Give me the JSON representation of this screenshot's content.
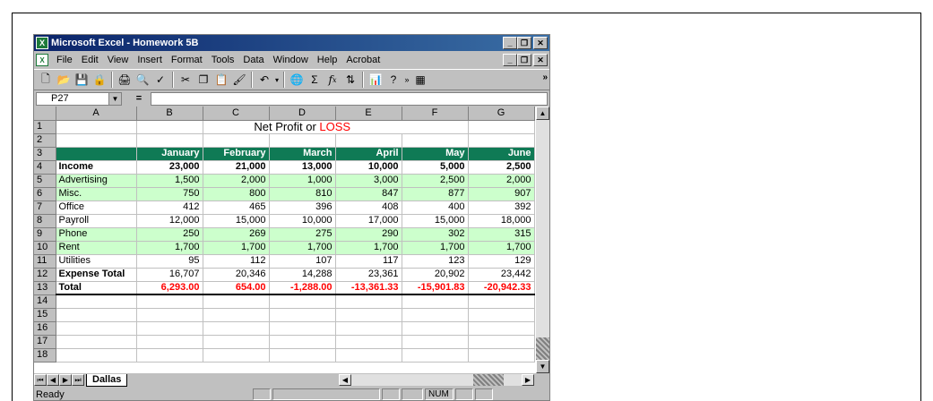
{
  "window": {
    "title": "Microsoft Excel - Homework 5B",
    "app_icon": "excel-icon",
    "controls": [
      "_",
      "И",
      "×"
    ]
  },
  "menu": {
    "items": [
      {
        "label": "File",
        "accel": "F"
      },
      {
        "label": "Edit",
        "accel": "E"
      },
      {
        "label": "View",
        "accel": "V"
      },
      {
        "label": "Insert",
        "accel": "I"
      },
      {
        "label": "Format",
        "accel": "o"
      },
      {
        "label": "Tools",
        "accel": "T"
      },
      {
        "label": "Data",
        "accel": "D"
      },
      {
        "label": "Window",
        "accel": "W"
      },
      {
        "label": "Help",
        "accel": "H"
      },
      {
        "label": "Acrobat",
        "accel": "b"
      }
    ]
  },
  "toolbar": {
    "buttons": [
      "new-icon",
      "open-icon",
      "save-icon",
      "permission-icon",
      "print-icon",
      "print-preview-icon",
      "spelling-icon",
      "cut-icon",
      "copy-icon",
      "paste-icon",
      "format-painter-icon",
      "undo-icon",
      "hyperlink-icon",
      "autosum-icon",
      "function-icon",
      "sort-ascending-icon",
      "chart-wizard-icon",
      "help-icon",
      "more-buttons-icon",
      "borders-icon"
    ]
  },
  "formula_bar": {
    "name_box": "P27",
    "equals": "=",
    "formula": ""
  },
  "columns": [
    "A",
    "B",
    "C",
    "D",
    "E",
    "F",
    "G"
  ],
  "rows": [
    {
      "n": "1",
      "type": "title",
      "cells": []
    },
    {
      "n": "2",
      "type": "empty",
      "cells": [
        "",
        "",
        "",
        "",
        "",
        "",
        ""
      ]
    },
    {
      "n": "3",
      "type": "hdr",
      "cells": [
        "",
        "January",
        "February",
        "March",
        "April",
        "May",
        "June"
      ]
    },
    {
      "n": "4",
      "type": "bold",
      "cells": [
        "Income",
        "23,000",
        "21,000",
        "13,000",
        "10,000",
        "5,000",
        "2,500"
      ]
    },
    {
      "n": "5",
      "type": "shade",
      "cells": [
        "Advertising",
        "1,500",
        "2,000",
        "1,000",
        "3,000",
        "2,500",
        "2,000"
      ]
    },
    {
      "n": "6",
      "type": "shade",
      "cells": [
        "Misc.",
        "750",
        "800",
        "810",
        "847",
        "877",
        "907"
      ]
    },
    {
      "n": "7",
      "type": "plain",
      "cells": [
        "Office",
        "412",
        "465",
        "396",
        "408",
        "400",
        "392"
      ]
    },
    {
      "n": "8",
      "type": "plain",
      "cells": [
        "Payroll",
        "12,000",
        "15,000",
        "10,000",
        "17,000",
        "15,000",
        "18,000"
      ]
    },
    {
      "n": "9",
      "type": "shade",
      "cells": [
        "Phone",
        "250",
        "269",
        "275",
        "290",
        "302",
        "315"
      ]
    },
    {
      "n": "10",
      "type": "shade",
      "cells": [
        "Rent",
        "1,700",
        "1,700",
        "1,700",
        "1,700",
        "1,700",
        "1,700"
      ]
    },
    {
      "n": "11",
      "type": "plain",
      "cells": [
        "Utilities",
        "95",
        "112",
        "107",
        "117",
        "123",
        "129"
      ]
    },
    {
      "n": "12",
      "type": "plainbold",
      "cells": [
        "Expense Total",
        "16,707",
        "20,346",
        "14,288",
        "23,361",
        "20,902",
        "23,442"
      ]
    },
    {
      "n": "13",
      "type": "total",
      "cells": [
        "Total",
        "6,293.00",
        "654.00",
        "-1,288.00",
        "-13,361.33",
        "-15,901.83",
        "-20,942.33"
      ]
    },
    {
      "n": "14",
      "type": "empty",
      "cells": [
        "",
        "",
        "",
        "",
        "",
        "",
        ""
      ]
    },
    {
      "n": "15",
      "type": "empty",
      "cells": [
        "",
        "",
        "",
        "",
        "",
        "",
        ""
      ]
    },
    {
      "n": "16",
      "type": "empty",
      "cells": [
        "",
        "",
        "",
        "",
        "",
        "",
        ""
      ]
    },
    {
      "n": "17",
      "type": "empty",
      "cells": [
        "",
        "",
        "",
        "",
        "",
        "",
        ""
      ]
    },
    {
      "n": "18",
      "type": "empty",
      "cells": [
        "",
        "",
        "",
        "",
        "",
        "",
        ""
      ]
    }
  ],
  "title_row": {
    "text": "Net Profit or ",
    "highlight": "LOSS"
  },
  "sheet_tabs": [
    "Dallas"
  ],
  "status": {
    "ready": "Ready",
    "num": "NUM"
  },
  "colors": {
    "header_green": "#0f7a55",
    "band_green": "#ccffcc",
    "negative": "#ff0000",
    "titlebar": "#0a246a"
  }
}
